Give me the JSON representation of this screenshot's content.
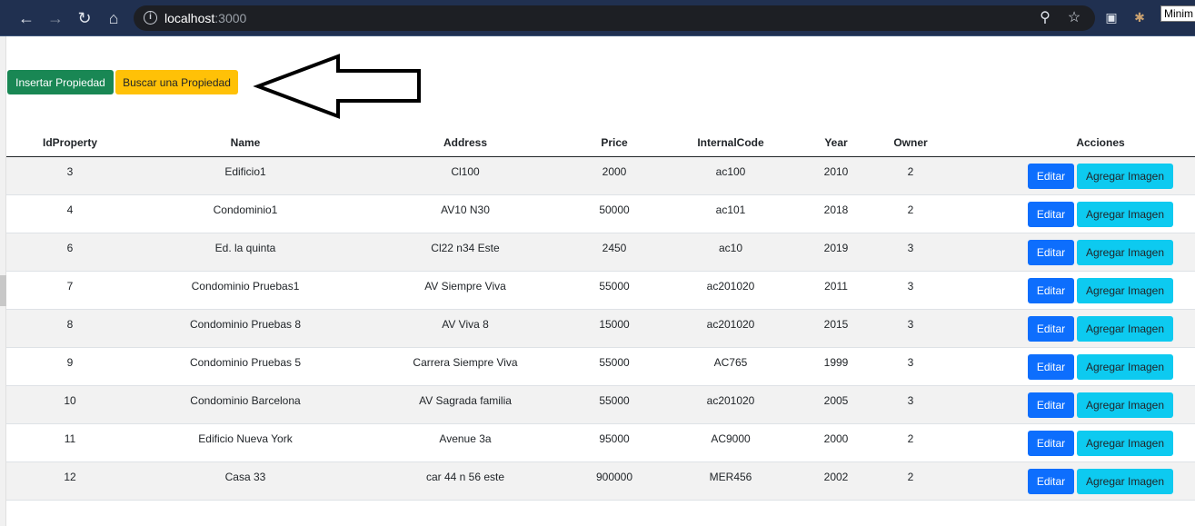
{
  "browser": {
    "url_host": "localhost",
    "url_port": ":3000",
    "tooltip": "Minim"
  },
  "icons": {
    "back": "back-arrow-icon",
    "forward": "forward-arrow-icon",
    "reload": "reload-icon",
    "home": "home-icon",
    "info": "info-icon",
    "zoom": "zoom-icon",
    "bookmark": "star-icon",
    "office": "office-extension-icon",
    "bug": "bug-extension-icon",
    "ext": "extension-icon"
  },
  "toolbar": {
    "insert_label": "Insertar Propiedad",
    "search_label": "Buscar una Propiedad"
  },
  "table": {
    "headers": [
      "IdProperty",
      "Name",
      "Address",
      "Price",
      "InternalCode",
      "Year",
      "Owner",
      "Acciones"
    ],
    "edit_label": "Editar",
    "image_label": "Agregar Imagen",
    "rows": [
      {
        "id": "3",
        "name": "Edificio1",
        "address": "Cl100",
        "price": "2000",
        "code": "ac100",
        "year": "2010",
        "owner": "2"
      },
      {
        "id": "4",
        "name": "Condominio1",
        "address": "AV10 N30",
        "price": "50000",
        "code": "ac101",
        "year": "2018",
        "owner": "2"
      },
      {
        "id": "6",
        "name": "Ed. la quinta",
        "address": "Cl22 n34 Este",
        "price": "2450",
        "code": "ac10",
        "year": "2019",
        "owner": "3"
      },
      {
        "id": "7",
        "name": "Condominio Pruebas1",
        "address": "AV Siempre Viva",
        "price": "55000",
        "code": "ac201020",
        "year": "2011",
        "owner": "3"
      },
      {
        "id": "8",
        "name": "Condominio Pruebas 8",
        "address": "AV Viva 8",
        "price": "15000",
        "code": "ac201020",
        "year": "2015",
        "owner": "3"
      },
      {
        "id": "9",
        "name": "Condominio Pruebas 5",
        "address": "Carrera Siempre Viva",
        "price": "55000",
        "code": "AC765",
        "year": "1999",
        "owner": "3"
      },
      {
        "id": "10",
        "name": "Condominio Barcelona",
        "address": "AV Sagrada familia",
        "price": "55000",
        "code": "ac201020",
        "year": "2005",
        "owner": "3"
      },
      {
        "id": "11",
        "name": "Edificio Nueva York",
        "address": "Avenue 3a",
        "price": "95000",
        "code": "AC9000",
        "year": "2000",
        "owner": "2"
      },
      {
        "id": "12",
        "name": "Casa 33",
        "address": "car 44 n 56 este",
        "price": "900000",
        "code": "MER456",
        "year": "2002",
        "owner": "2"
      }
    ]
  },
  "colors": {
    "success": "#198754",
    "warning": "#ffc107",
    "primary": "#0d6efd",
    "info": "#0dcaf0",
    "chrome": "#203050"
  }
}
